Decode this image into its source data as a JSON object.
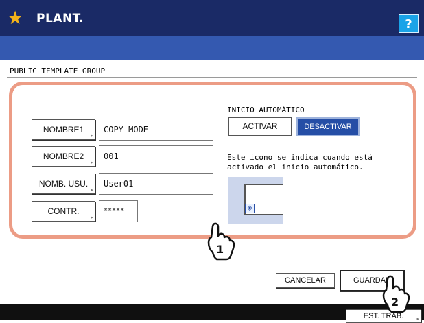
{
  "header": {
    "title": "PLANT.",
    "star_icon": "star-icon",
    "help_label": "?"
  },
  "group_title": "PUBLIC TEMPLATE GROUP",
  "form": {
    "name1": {
      "label": "NOMBRE1",
      "value": "COPY MODE"
    },
    "name2": {
      "label": "NOMBRE2",
      "value": "001"
    },
    "user": {
      "label": "NOMB. USU.",
      "value": "User01"
    },
    "password": {
      "label": "CONTR.",
      "value": "*****"
    }
  },
  "auto_start": {
    "title": "INICIO AUTOMÁTICO",
    "activate_label": "ACTIVAR",
    "deactivate_label": "DESACTIVAR",
    "selected": "DESACTIVAR",
    "info_line1": "Este icono se indica cuando está",
    "info_line2": "activado el inicio automático."
  },
  "actions": {
    "cancel_label": "CANCELAR",
    "save_label": "GUARDAR"
  },
  "footer": {
    "job_status_label": "EST. TRAB."
  },
  "callouts": [
    "1",
    "2"
  ],
  "colors": {
    "titlebar": "#1a2a66",
    "band": "#3459b0",
    "help_button": "#1aa3e8",
    "highlight_outline": "#ec9c85",
    "selected_button": "#254ea6",
    "star": "#f2b21a"
  }
}
